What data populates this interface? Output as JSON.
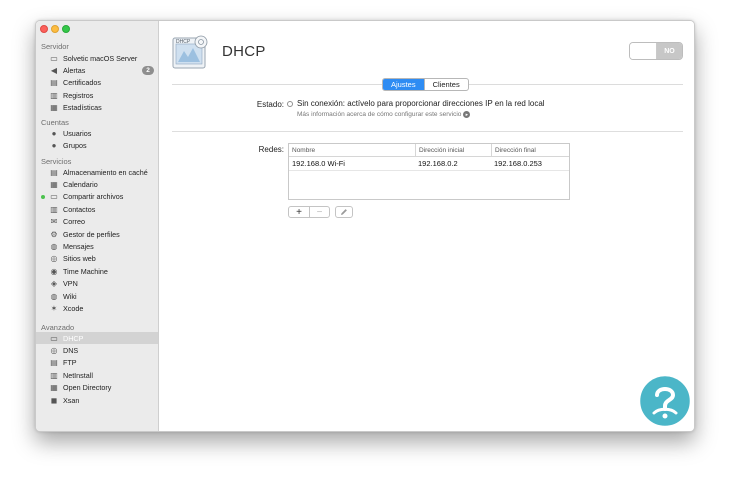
{
  "sidebar": {
    "sections": [
      {
        "header": "Servidor",
        "items": [
          {
            "label": "Solvetic macOS Server",
            "icon": "server-icon"
          },
          {
            "label": "Alertas",
            "icon": "bell-icon",
            "badge": "2"
          },
          {
            "label": "Certificados",
            "icon": "certificate-icon"
          },
          {
            "label": "Registros",
            "icon": "log-icon"
          },
          {
            "label": "Estadísticas",
            "icon": "stats-icon"
          }
        ]
      },
      {
        "header": "Cuentas",
        "items": [
          {
            "label": "Usuarios",
            "icon": "user-icon"
          },
          {
            "label": "Grupos",
            "icon": "group-icon"
          }
        ]
      },
      {
        "header": "Servicios",
        "items": [
          {
            "label": "Almacenamiento en caché",
            "icon": "cache-icon"
          },
          {
            "label": "Calendario",
            "icon": "calendar-icon"
          },
          {
            "label": "Compartir archivos",
            "icon": "folder-icon",
            "active": true
          },
          {
            "label": "Contactos",
            "icon": "contacts-icon"
          },
          {
            "label": "Correo",
            "icon": "mail-icon"
          },
          {
            "label": "Gestor de perfiles",
            "icon": "profile-icon"
          },
          {
            "label": "Mensajes",
            "icon": "messages-icon"
          },
          {
            "label": "Sitios web",
            "icon": "globe-icon"
          },
          {
            "label": "Time Machine",
            "icon": "time-machine-icon"
          },
          {
            "label": "VPN",
            "icon": "vpn-icon"
          },
          {
            "label": "Wiki",
            "icon": "wiki-icon"
          },
          {
            "label": "Xcode",
            "icon": "xcode-icon"
          }
        ]
      },
      {
        "header": "Avanzado",
        "items": [
          {
            "label": "DHCP",
            "icon": "dhcp-icon",
            "selected": true
          },
          {
            "label": "DNS",
            "icon": "dns-icon"
          },
          {
            "label": "FTP",
            "icon": "ftp-icon"
          },
          {
            "label": "NetInstall",
            "icon": "netinstall-icon"
          },
          {
            "label": "Open Directory",
            "icon": "open-directory-icon"
          },
          {
            "label": "Xsan",
            "icon": "xsan-icon"
          }
        ]
      }
    ]
  },
  "header": {
    "logo_text": "DHCP",
    "title": "DHCP",
    "toggle_label": "NO"
  },
  "tabs": [
    {
      "label": "Ajustes",
      "active": true
    },
    {
      "label": "Clientes",
      "active": false
    }
  ],
  "estado": {
    "label": "Estado:",
    "text": "Sin conexión: actívelo para proporcionar direcciones IP en la red local",
    "link": "Más información acerca de cómo configurar este servicio"
  },
  "redes": {
    "label": "Redes:",
    "columns": [
      "Nombre",
      "Dirección inicial",
      "Dirección final"
    ],
    "rows": [
      [
        "192.168.0 Wi-Fi",
        "192.168.0.2",
        "192.168.0.253"
      ]
    ]
  },
  "table_buttons": {
    "add": "+",
    "remove": "−"
  },
  "colors": {
    "accent": "#2e8cf3",
    "selected_row": "#d3d3d3",
    "watermark": "#4bb6c8"
  }
}
